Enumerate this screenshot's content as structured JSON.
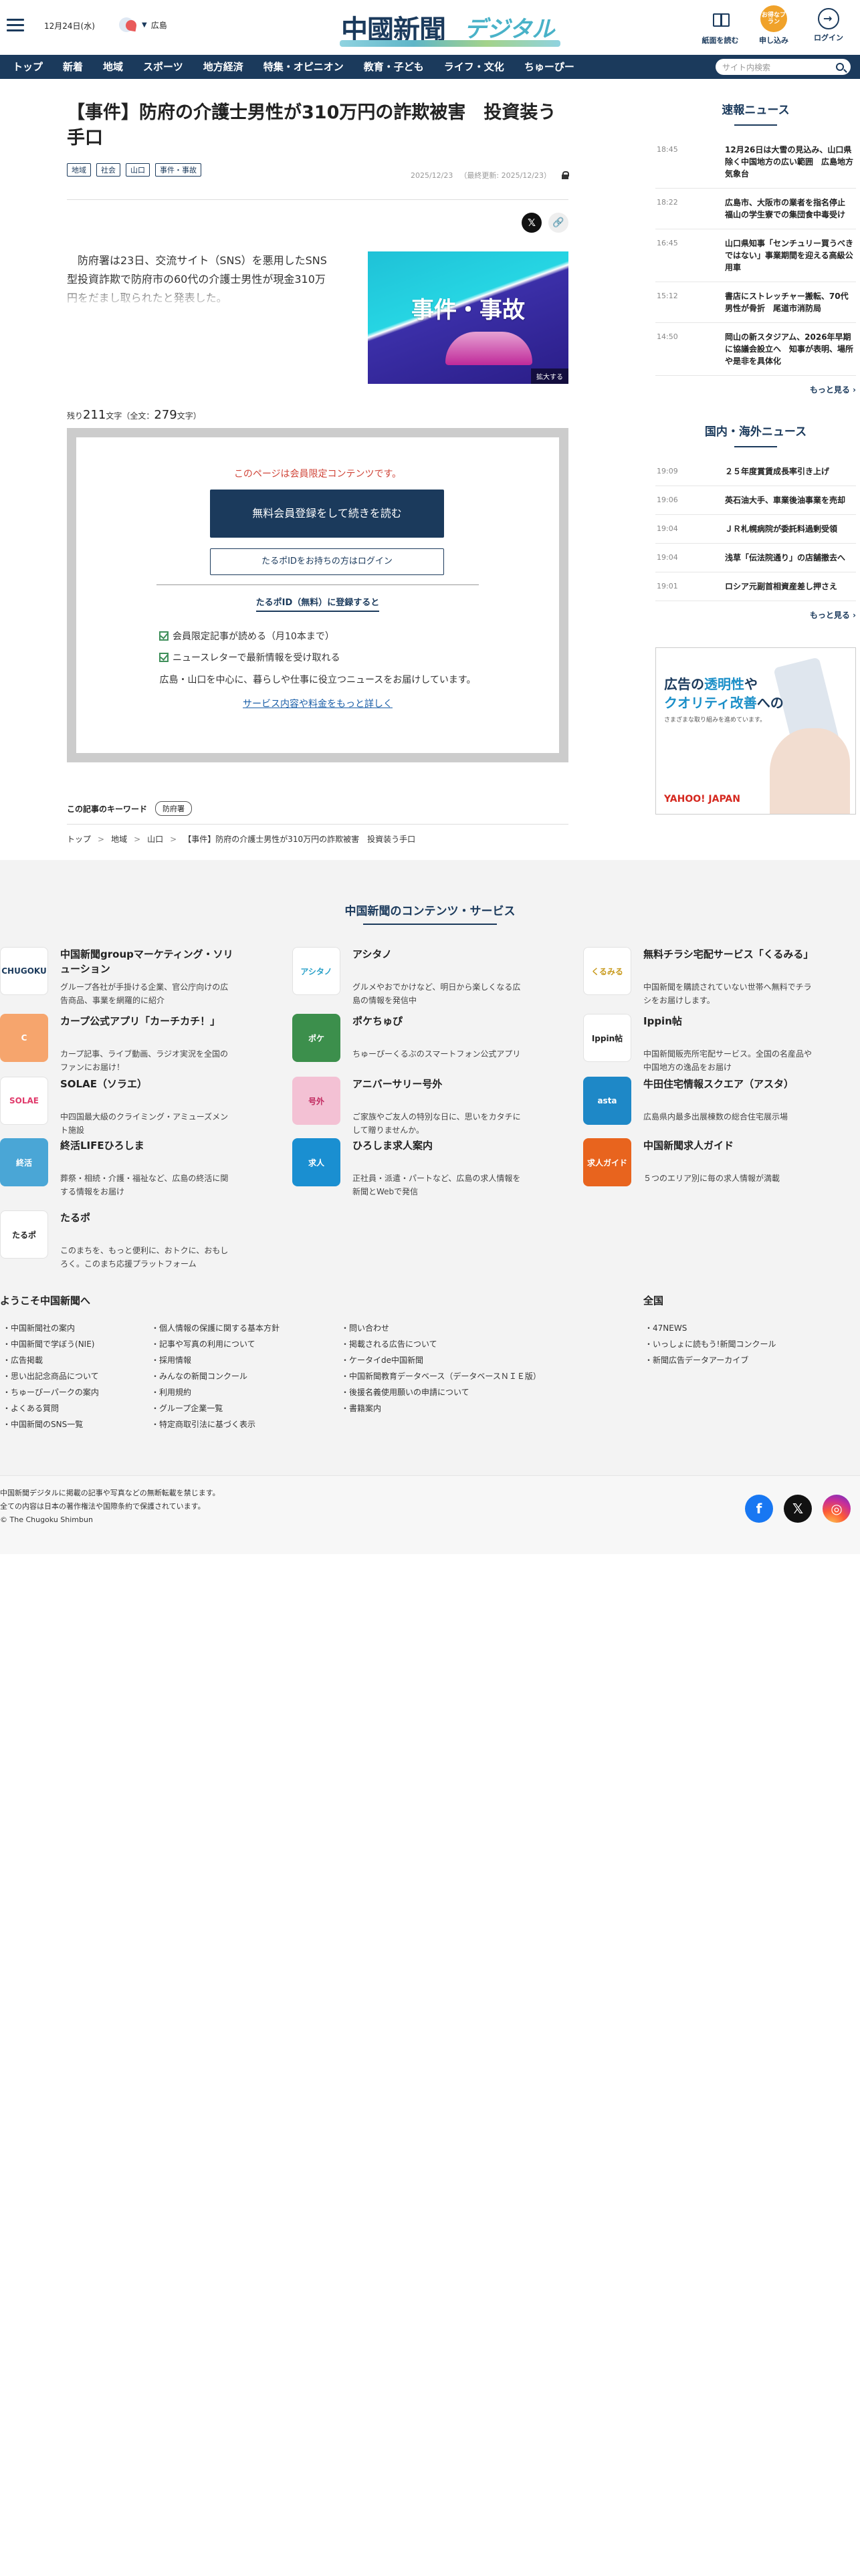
{
  "header": {
    "date": "12月24日(水)",
    "weather_area": "広島",
    "logo_main": "中國新聞",
    "logo_sub": "デジタル",
    "buttons": [
      "紙面を読む",
      "申し込み",
      "ログイン"
    ],
    "subscribe_badge": "お得なプラン"
  },
  "nav": {
    "items": [
      "トップ",
      "新着",
      "地域",
      "スポーツ",
      "地方経済",
      "特集・オピニオン",
      "教育・子ども",
      "ライフ・文化",
      "ちゅーぴー"
    ],
    "search_placeholder": "サイト内検索"
  },
  "article": {
    "title": "【事件】防府の介護士男性が310万円の詐欺被害　投資装う手口",
    "tags": [
      "地域",
      "社会",
      "山口",
      "事件・事故"
    ],
    "date": "2025/12/23",
    "updated": "（最終更新: 2025/12/23）",
    "lead": "防府署は23日、交流サイト（SNS）を悪用したSNS型投資詐欺で防府市の60代の介護士男性が現金310万円をだまし取られたと発表した。",
    "photo_text": "事件・事故",
    "photo_zoom": "拡大する",
    "remain_prefix": "残り",
    "remain": "211",
    "remain_unit": "文字（全文：",
    "total": "279",
    "total_suffix": "文字）",
    "keyword_label": "この記事のキーワード",
    "keyword": "防府署",
    "breadcrumb": [
      "トップ",
      "地域",
      "山口",
      "【事件】防府の介護士男性が310万円の詐欺被害　投資装う手口"
    ]
  },
  "paywall": {
    "heading": "このページは会員限定コンテンツです。",
    "register_button": "無料会員登録をして続きを読む",
    "login_button": "たるポIDをお持ちの方はログイン",
    "register_heading": "たるポID（無料）に登録すると",
    "benefits": [
      "会員限定記事が読める（月10本まで）",
      "ニュースレターで最新情報を受け取れる"
    ],
    "description": "広島・山口を中心に、暮らしや仕事に役立つニュースをお届けしています。",
    "details_link": "サービス内容や料金をもっと詳しく"
  },
  "sidebar": {
    "breaking_title": "速報ニュース",
    "breaking": [
      {
        "time": "18:45",
        "headline": "12月26日は大雪の見込み、山口県除く中国地方の広い範囲　広島地方気象台"
      },
      {
        "time": "18:22",
        "headline": "広島市、大阪市の業者を指名停止　福山の学生寮での集団食中毒受け"
      },
      {
        "time": "16:45",
        "headline": "山口県知事「センチュリー買うべきではない」事業期間を迎える高級公用車"
      },
      {
        "time": "15:12",
        "headline": "書店にストレッチャー搬転、70代男性が骨折　尾道市消防局"
      },
      {
        "time": "14:50",
        "headline": "岡山の新スタジアム、2026年早期に協議会設立へ　知事が表明、場所や是非を具体化"
      }
    ],
    "more": "もっと見る",
    "world_title": "国内・海外ニュース",
    "world": [
      {
        "time": "19:09",
        "headline": "２５年度賞賃成長率引き上げ"
      },
      {
        "time": "19:06",
        "headline": "英石油大手、車業後油事業を売却"
      },
      {
        "time": "19:04",
        "headline": "ＪＲ札幌病院が委託料過剰受領"
      },
      {
        "time": "19:04",
        "headline": "浅草「伝法院通り」の店舗撤去へ"
      },
      {
        "time": "19:01",
        "headline": "ロシア元副首相資産差し押さえ"
      }
    ],
    "ad": {
      "line1a": "広告の",
      "line1b": "透明性",
      "line1c": "や",
      "line2a": "クオリティ改善",
      "line2b": "への",
      "line3": "さまざまな取り組みを進めています。",
      "brand": "YAHOO! JAPAN"
    }
  },
  "services": {
    "title": "中国新聞のコンテンツ・サービス",
    "items": [
      {
        "name": "中国新聞groupマーケティング・ソリューション",
        "desc": "グループ各社が手掛ける企業、官公庁向けの広告商品、事業を網羅的に紹介",
        "icon": "CHUGOKU",
        "color": "#ffffff",
        "fg": "#1b3a5c"
      },
      {
        "name": "アシタノ",
        "desc": "グルメやおでかけなど、明日から楽しくなる広島の情報を発信中",
        "icon": "アシタノ",
        "color": "#ffffff",
        "fg": "#2aa1c9"
      },
      {
        "name": "無料チラシ宅配サービス「くるみる」",
        "desc": "中国新聞を購読されていない世帯へ無料でチラシをお届けします。",
        "icon": "くるみる",
        "color": "#ffffff",
        "fg": "#c89a1c"
      },
      {
        "name": "カープ公式アプリ「カーチカチ！」",
        "desc": "カープ記事、ライブ動画、ラジオ実況を全国のファンにお届け！",
        "icon": "C",
        "color": "#f6a56d",
        "fg": "#ffffff"
      },
      {
        "name": "ポケちゅぴ",
        "desc": "ちゅーぴーくるぶのスマートフォン公式アプリ",
        "icon": "ポケ",
        "color": "#3c8f4c",
        "fg": "#ffffff"
      },
      {
        "name": "Ippin帖",
        "desc": "中国新聞販売所宅配サービス。全国の名産品や中国地方の逸品をお届け",
        "icon": "Ippin帖",
        "color": "#ffffff",
        "fg": "#222222"
      },
      {
        "name": "SOLAE（ソラエ）",
        "desc": "中四国最大級のクライミング・アミューズメント施設",
        "icon": "SOLAE",
        "color": "#ffffff",
        "fg": "#e03a6b"
      },
      {
        "name": "アニバーサリー号外",
        "desc": "ご家族やご友人の特別な日に、思いをカタチにして贈りませんか。",
        "icon": "号外",
        "color": "#f3c1d4",
        "fg": "#c22b61"
      },
      {
        "name": "牛田住宅情報スクエア（アスタ）",
        "desc": "広島県内最多出展棟数の総合住宅展示場",
        "icon": "asta",
        "color": "#1e88c7",
        "fg": "#ffffff"
      },
      {
        "name": "終活LIFEひろしま",
        "desc": "葬祭・相続・介護・福祉など、広島の終活に関する情報をお届け",
        "icon": "終活",
        "color": "#4aa6d6",
        "fg": "#ffffff"
      },
      {
        "name": "ひろしま求人案内",
        "desc": "正社員・派遣・パートなど、広島の求人情報を新聞とWebで発信",
        "icon": "求人",
        "color": "#1a8fd1",
        "fg": "#ffffff"
      },
      {
        "name": "中国新聞求人ガイド",
        "desc": "５つのエリア別に毎の求人情報が満載",
        "icon": "求人ガイド",
        "color": "#e8641e",
        "fg": "#ffffff"
      },
      {
        "name": "たるポ",
        "desc": "このまちを、もっと便利に、おトクに、おもしろく。このまち応援プラットフォーム",
        "icon": "たるポ",
        "color": "#ffffff",
        "fg": "#222222"
      }
    ]
  },
  "footer": {
    "welcome": "ようこそ中国新聞へ",
    "national": "全国",
    "col1": [
      "中国新聞社の案内",
      "中国新聞で学ぼう(NIE)",
      "広告掲載",
      "思い出記念商品について",
      "ちゅーぴーパークの案内",
      "よくある質問",
      "中国新聞のSNS一覧"
    ],
    "col2": [
      "個人情報の保護に関する基本方針",
      "記事や写真の利用について",
      "採用情報",
      "みんなの新聞コンクール",
      "利用規約",
      "グループ企業一覧",
      "特定商取引法に基づく表示"
    ],
    "col3": [
      "問い合わせ",
      "掲載される広告について",
      "ケータイde中国新聞",
      "中国新聞教育データベース（データベースＮＩＥ版）",
      "後援名義使用願いの申請について",
      "書籍案内"
    ],
    "col4": [
      "47NEWS",
      "いっしょに読もう!新聞コンクール",
      "新聞広告データアーカイブ"
    ],
    "copyright": [
      "中国新聞デジタルに掲載の記事や写真などの無断転載を禁じます。",
      "全ての内容は日本の著作権法や国際条約で保護されています。",
      "© The Chugoku Shimbun"
    ]
  }
}
